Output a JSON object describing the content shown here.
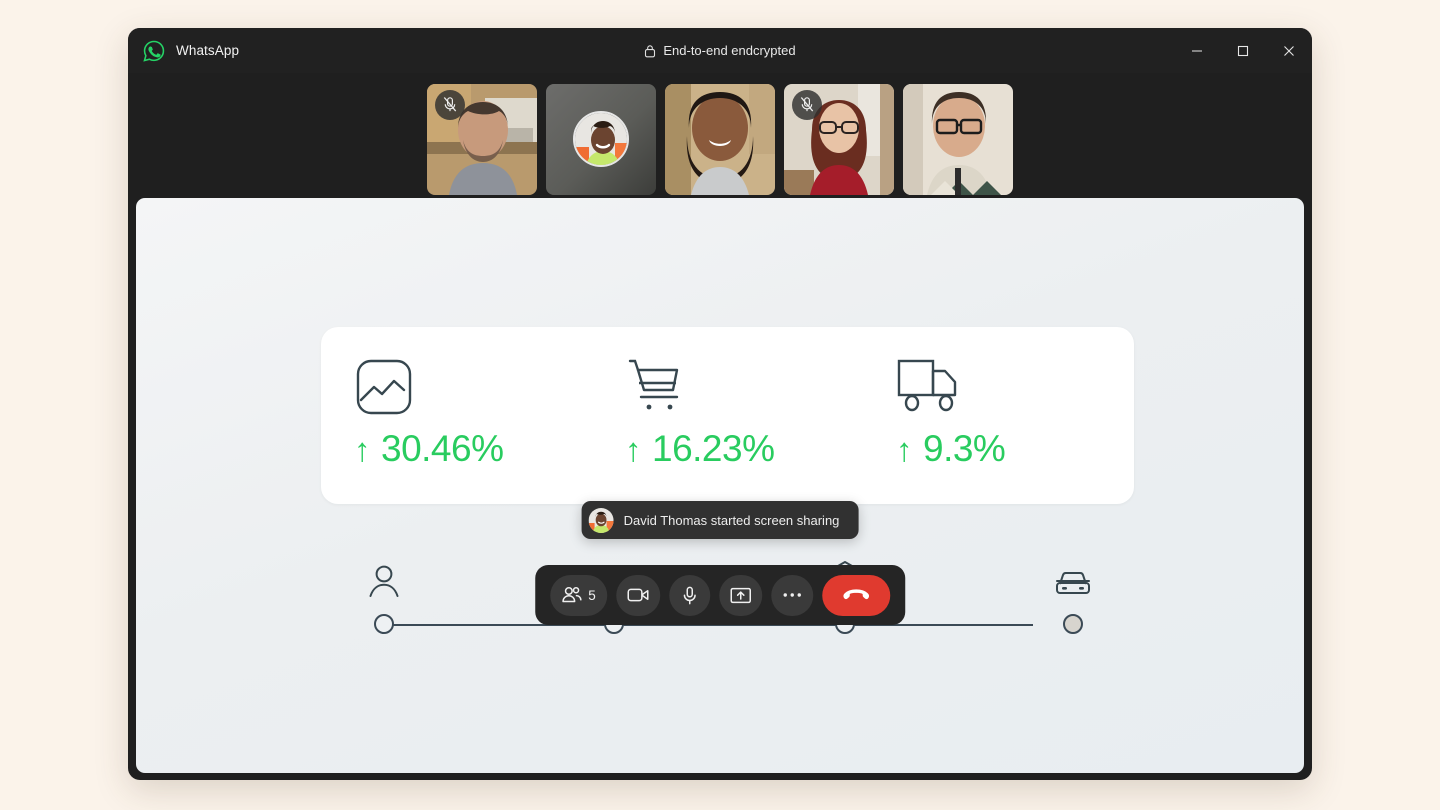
{
  "app": {
    "brand_name": "WhatsApp",
    "logo_icon": "whatsapp-logo-icon",
    "encryption_label": "End-to-end endcrypted",
    "lock_icon": "lock-icon",
    "brand_color": "#25d366"
  },
  "window_controls": [
    {
      "name": "minimize",
      "icon": "minimize-icon"
    },
    {
      "name": "maximize",
      "icon": "maximize-icon"
    },
    {
      "name": "close",
      "icon": "close-icon"
    }
  ],
  "participants": [
    {
      "name": "participant-1",
      "camera_on": true,
      "muted": true,
      "skin": "#c79a7c",
      "bg": "#9f8158",
      "shirt": "#8e929a"
    },
    {
      "name": "participant-2",
      "camera_on": false,
      "muted": false,
      "avatar_skin": "#6b4430",
      "avatar_bg": "#e8e6e2",
      "avatar_shirt": "#c5e86c"
    },
    {
      "name": "participant-3",
      "camera_on": true,
      "muted": false,
      "skin": "#8a5a3c",
      "bg": "#cbb289",
      "shirt": "#c9cbcc"
    },
    {
      "name": "participant-4",
      "camera_on": true,
      "muted": true,
      "skin": "#e0b79a",
      "bg": "#d9cfc2",
      "shirt": "#a51d2a"
    },
    {
      "name": "participant-5",
      "camera_on": true,
      "muted": false,
      "skin": "#d8ab8c",
      "bg": "#e7e0d4",
      "shirt": "#5c6b58"
    }
  ],
  "shared_screen": {
    "kpis": [
      {
        "icon": "line-chart-icon",
        "arrow": "↑",
        "value": "30.46%"
      },
      {
        "icon": "shopping-cart-icon",
        "arrow": "↑",
        "value": "16.23%"
      },
      {
        "icon": "delivery-truck-icon",
        "arrow": "↑",
        "value": "9.3%"
      }
    ],
    "kpi_color": "#29cc5f",
    "stepper": {
      "steps": [
        {
          "icon": "person-icon",
          "filled": false
        },
        {
          "icon": "shopping-bag-icon",
          "filled": false
        },
        {
          "icon": "package-box-icon",
          "filled": false
        },
        {
          "icon": "car-icon",
          "filled": true
        }
      ]
    }
  },
  "toast": {
    "avatar_icon": "user-avatar",
    "message": "David Thomas started screen sharing"
  },
  "call_controls": [
    {
      "name": "participants-button",
      "icon": "people-icon",
      "label": "5"
    },
    {
      "name": "camera-button",
      "icon": "video-camera-icon",
      "label": ""
    },
    {
      "name": "microphone-button",
      "icon": "microphone-icon",
      "label": ""
    },
    {
      "name": "share-screen-button",
      "icon": "share-screen-icon",
      "label": ""
    },
    {
      "name": "more-options-button",
      "icon": "ellipsis-icon",
      "label": ""
    },
    {
      "name": "end-call-button",
      "icon": "phone-hangup-icon",
      "label": ""
    }
  ]
}
